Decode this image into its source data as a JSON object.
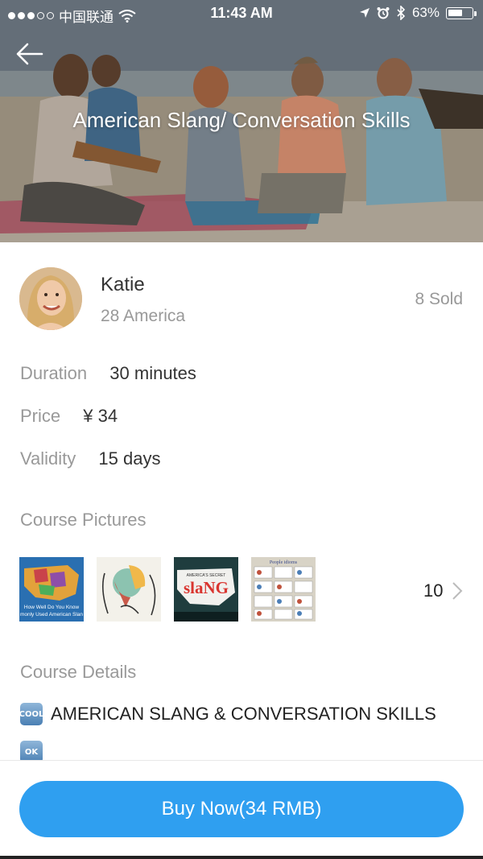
{
  "status_bar": {
    "carrier": "中国联通",
    "time": "11:43 AM",
    "battery": "63%",
    "battery_level": 0.63
  },
  "hero": {
    "title": "American Slang/ Conversation Skills",
    "back_icon": "arrow-left-icon"
  },
  "teacher": {
    "name": "Katie",
    "meta": "28 America",
    "sold": "8 Sold"
  },
  "info": {
    "duration_label": "Duration",
    "duration_value": "30 minutes",
    "price_label": "Price",
    "price_value": "¥ 34",
    "validity_label": "Validity",
    "validity_value": "15 days"
  },
  "pictures": {
    "title": "Course Pictures",
    "count": "10",
    "thumbs": [
      {
        "caption": "How Well Do You Know",
        "caption2": "monly Used American Slan"
      },
      {
        "caption": ""
      },
      {
        "caption": "AMERICA'S SECRET",
        "caption2": "slaNG"
      },
      {
        "caption": "People idioms"
      }
    ]
  },
  "details": {
    "title": "Course Details",
    "badge1": "COOL",
    "line1": "AMERICAN SLANG & CONVERSATION SKILLS",
    "badge2": "OK"
  },
  "buy": {
    "label": "Buy Now(34 RMB)"
  },
  "colors": {
    "accent": "#2f9ff0"
  }
}
